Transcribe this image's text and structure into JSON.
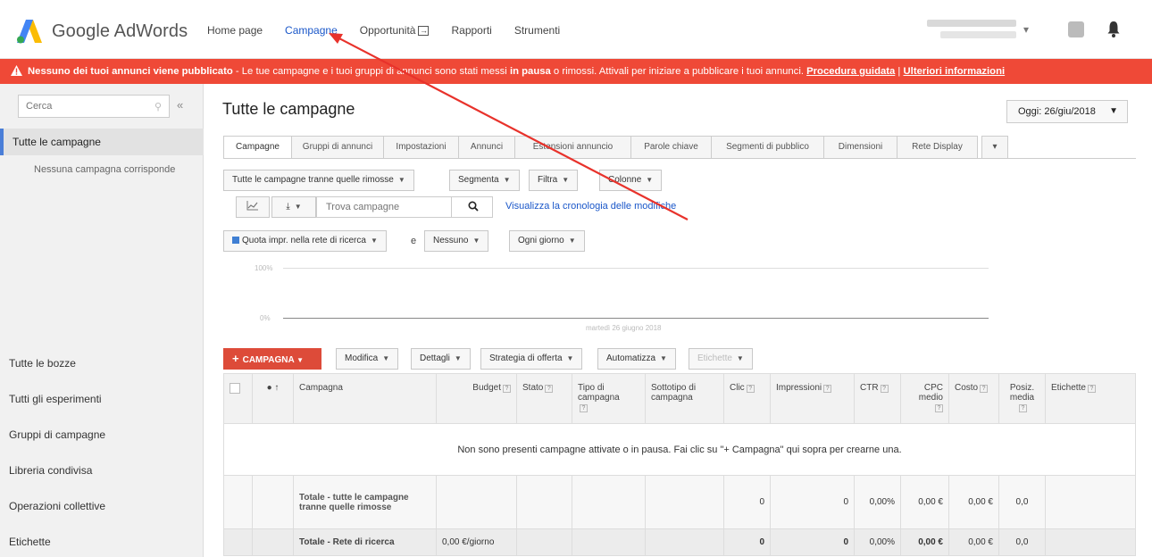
{
  "app": {
    "name": "Google AdWords",
    "brand_colors": {
      "blue": "#4285f4",
      "yellow": "#fbbc05",
      "green": "#34a853"
    }
  },
  "topnav": [
    {
      "label": "Home page",
      "active": false
    },
    {
      "label": "Campagne",
      "active": true
    },
    {
      "label": "Opportunità",
      "active": false,
      "icon": "external-box-icon"
    },
    {
      "label": "Rapporti",
      "active": false
    },
    {
      "label": "Strumenti",
      "active": false
    }
  ],
  "alert": {
    "color": "#ef4937",
    "bold_text": "Nessuno dei tuoi annunci viene pubblicato",
    "text_part1": " - Le tue campagne e i tuoi gruppi di annunci sono stati messi ",
    "text_bold2": "in pausa",
    "text_part2": " o rimossi. Attivali per iniziare a pubblicare i tuoi annunci. ",
    "link1": "Procedura guidata",
    "separator": " | ",
    "link2": "Ulteriori informazioni"
  },
  "sidebar": {
    "search_placeholder": "Cerca",
    "collapse_label": "«",
    "active_item": "Tutte le campagne",
    "empty_text": "Nessuna campagna corrisponde",
    "links": [
      "Tutte le bozze",
      "Tutti gli esperimenti",
      "Gruppi di campagne",
      "Libreria condivisa",
      "Operazioni collettive",
      "Etichette"
    ]
  },
  "main": {
    "title": "Tutte le campagne",
    "date_range": "Oggi: 26/giu/2018",
    "tabs": [
      "Campagne",
      "Gruppi di annunci",
      "Impostazioni",
      "Annunci",
      "Estensioni annuncio",
      "Parole chiave",
      "Segmenti di pubblico",
      "Dimensioni",
      "Rete Display"
    ],
    "filters": {
      "status_filter": "Tutte le campagne tranne quelle rimosse",
      "segment": "Segmenta",
      "filter": "Filtra",
      "columns": "Colonne"
    },
    "find_placeholder": "Trova campagne",
    "history_link": "Visualizza la cronologia delle modifiche",
    "metric1": "Quota impr. nella rete di ricerca",
    "conjunction": "e",
    "metric2": "Nessuno",
    "granularity": "Ogni giorno",
    "chart": {
      "y_top": "100%",
      "y_bottom": "0%",
      "x_label": "martedì 26 giugno 2018"
    },
    "actions": {
      "add_campaign": "CAMPAGNA",
      "modify": "Modifica",
      "details": "Dettagli",
      "bid_strategy": "Strategia di offerta",
      "automate": "Automatizza",
      "labels": "Etichette"
    },
    "table": {
      "sort_arrow": "↑",
      "headers": [
        "Campagna",
        "Budget",
        "Stato",
        "Tipo di campagna",
        "Sottotipo di campagna",
        "Clic",
        "Impressioni",
        "CTR",
        "CPC medio",
        "Costo",
        "Posiz. media",
        "Etichette"
      ],
      "empty_message": "Non sono presenti campagne attivate o in pausa. Fai clic su \"+ Campagna\" qui sopra per crearne una.",
      "total_rows": [
        {
          "label": "Totale - tutte le campagne tranne quelle rimosse",
          "budget": "",
          "clicks": "0",
          "impressions": "0",
          "ctr": "0,00%",
          "cpc": "0,00 €",
          "cost": "0,00 €",
          "position": "0,0"
        },
        {
          "label": "Totale - Rete di ricerca",
          "budget": "0,00 €/giorno",
          "clicks": "0",
          "impressions": "0",
          "ctr": "0,00%",
          "cpc": "0,00 €",
          "cost": "0,00 €",
          "position": "0,0"
        }
      ]
    }
  },
  "annotation_color": "#e8322b"
}
